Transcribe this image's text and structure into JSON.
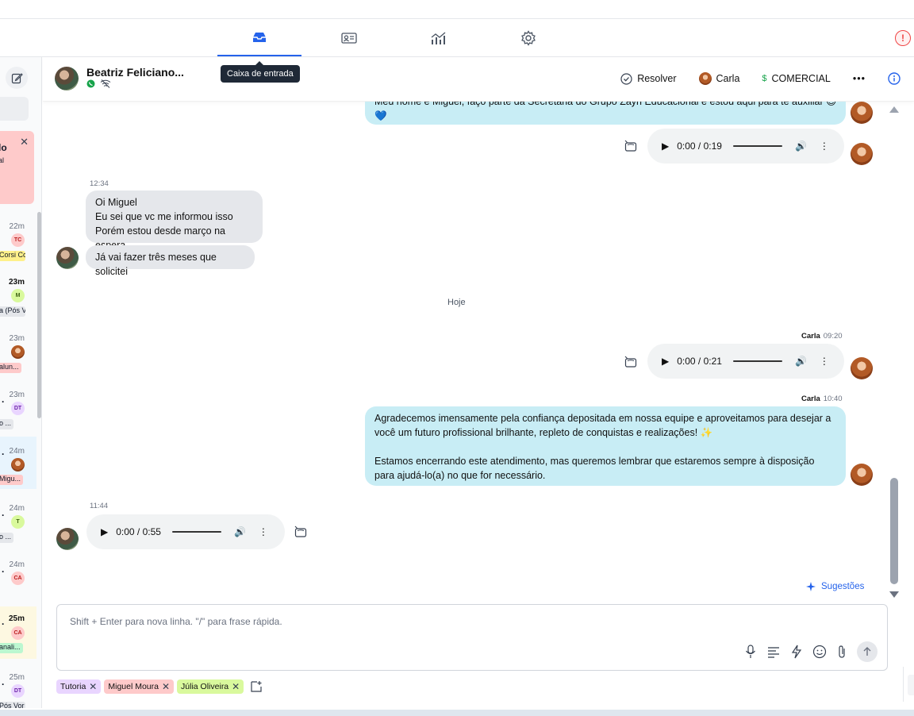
{
  "nav": {
    "tabs": [
      {
        "name": "inbox",
        "icon": "inbox-icon"
      },
      {
        "name": "contacts",
        "icon": "contact-card-icon"
      },
      {
        "name": "reports",
        "icon": "chart-icon"
      },
      {
        "name": "settings",
        "icon": "gear-icon"
      }
    ],
    "active_tab": "inbox",
    "tooltip": "Caixa de entrada",
    "alert_label": "!"
  },
  "sidebar": {
    "alert_card": {
      "title": "lo",
      "subtitle": "al"
    },
    "conversations": [
      {
        "time": "22m",
        "avatar": "TC",
        "tag": "Corsi Co"
      },
      {
        "time": "23m",
        "avatar": "M",
        "tag": "a (Pós V"
      },
      {
        "time": "23m",
        "avatar": "",
        "tag": "alun..."
      },
      {
        "time": "23m",
        "avatar": "DT",
        "tag": "o ..."
      },
      {
        "time": "24m",
        "avatar": "",
        "tag": "Migu..."
      },
      {
        "time": "24m",
        "avatar": "T",
        "tag": "o ..."
      },
      {
        "time": "24m",
        "avatar": "CA",
        "tag": ""
      },
      {
        "time": "25m",
        "avatar": "CA",
        "tag": "anali..."
      },
      {
        "time": "25m",
        "avatar": "DT",
        "tag": "Pós Vor"
      }
    ]
  },
  "header": {
    "contact_name": "Beatriz Feliciano...",
    "resolve_label": "Resolver",
    "agent_name": "Carla",
    "team_label": "COMERCIAL",
    "team_symbol": "$",
    "more_label": "•••"
  },
  "messages": {
    "top_partial": "Meu nome é Miguel, faço parte da Secretaria do Grupo Zayn Educacional e estou aqui para te auxiliar 😊",
    "top_emoji": "💙",
    "audio1": {
      "time": "0:00 / 0:19"
    },
    "in_time": "12:34",
    "in_lines": [
      "Oi Miguel",
      "Eu sei que vc me informou isso",
      "Porém estou desde março na espera"
    ],
    "in_second": "Já vai fazer três meses que solicitei",
    "day_separator": "Hoje",
    "audio2": {
      "sender": "Carla",
      "time_sent": "09:20",
      "time": "0:00 / 0:21"
    },
    "farewell": {
      "sender": "Carla",
      "time_sent": "10:40",
      "p1": "Agradecemos imensamente pela confiança depositada em nossa equipe e aproveitamos para desejar a você um futuro profissional brilhante, repleto de conquistas e realizações! ✨",
      "p2": "Estamos encerrando este atendimento, mas queremos lembrar que estaremos sempre à disposição para ajudá-lo(a) no que for necessário."
    },
    "audio3": {
      "time_sent": "11:44",
      "time": "0:00 / 0:55"
    }
  },
  "suggestions_label": "Sugestões",
  "composer": {
    "placeholder": "Shift + Enter para nova linha. \"/\" para frase rápida."
  },
  "tags": [
    {
      "label": "Tutoria",
      "color": "#e9d5ff"
    },
    {
      "label": "Miguel Moura",
      "color": "#fecaca"
    },
    {
      "label": "Júlia Oliveira",
      "color": "#d9f99d"
    }
  ],
  "colors": {
    "accent": "#2563eb",
    "outgoing_bubble": "#c8edf5",
    "incoming_bubble": "#e5e7eb",
    "whatsapp": "#16a34a"
  }
}
